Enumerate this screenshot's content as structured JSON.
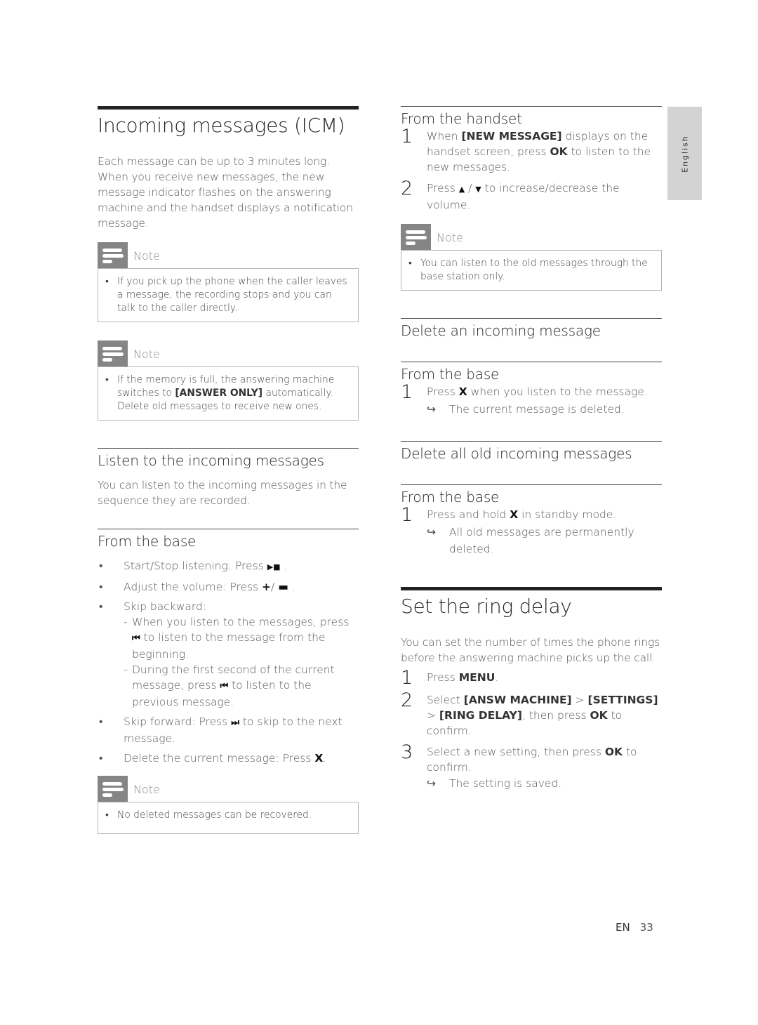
{
  "side_tab": {
    "label": "English"
  },
  "footer": {
    "lang": "EN",
    "page": "33"
  },
  "left": {
    "title": "Incoming messages (ICM)",
    "intro": "Each message can be up to 3 minutes long. When you receive new messages, the new message indicator flashes on the answering machine and the handset displays a notification message.",
    "notes": [
      {
        "label": "Note",
        "items": [
          "If you pick up the phone when the caller leaves a message, the recording stops and you can talk to the caller directly."
        ]
      },
      {
        "label": "Note",
        "items_rich": {
          "pre": "If the memory is full, the answering machine switches to ",
          "kw": "[ANSWER ONLY]",
          "post": " automatically. Delete old messages to receive new ones."
        }
      }
    ],
    "listen": {
      "heading": "Listen to the incoming messages",
      "text": "You can listen to the incoming messages in the sequence they are recorded."
    },
    "from_base": {
      "heading": "From the base",
      "bullets": {
        "start_stop": {
          "pre": "Start/Stop listening: Press ",
          "icon": "▶■",
          "post": " ."
        },
        "volume": {
          "pre": "Adjust the volume: Press ",
          "icon_plus": "+",
          "sep": "/ ",
          "icon_minus": "▬",
          "post": " ."
        },
        "skip_back": {
          "label": "Skip backward:",
          "sub1": {
            "pre": "When you listen to the messages, press ",
            "icon": "⏮",
            "post": " to listen to the message from the beginning."
          },
          "sub2": {
            "pre": "During the first second of the current message, press ",
            "icon": "⏮",
            "post": " to listen to the previous message."
          }
        },
        "skip_fwd": {
          "pre": "Skip forward: Press ",
          "icon": "⏭",
          "post": " to skip to the next message."
        },
        "delete": {
          "pre": "Delete the current message: Press ",
          "icon": "X",
          "post": "."
        }
      }
    },
    "note3": {
      "label": "Note",
      "text": "No deleted messages can be recovered."
    }
  },
  "right": {
    "handset": {
      "heading": "From the handset",
      "step1": {
        "num": "1",
        "pre": "When ",
        "kw1": "[NEW MESSAGE]",
        "mid": " displays on the handset screen, press ",
        "kw2": "OK",
        "post": " to listen to the new messages."
      },
      "step2": {
        "num": "2",
        "pre": "Press ",
        "icon_up": "▲",
        "sep": " / ",
        "icon_down": "▼",
        "post": " to increase/decrease the volume."
      }
    },
    "note": {
      "label": "Note",
      "text": "You can listen to the old messages through the base station only."
    },
    "delete_one": {
      "heading": "Delete an incoming message",
      "sub_heading": "From the base",
      "step1": {
        "num": "1",
        "pre": "Press ",
        "icon": "X",
        "post": " when you listen to the message."
      },
      "result": {
        "arrow": "↪",
        "text": "The current message is deleted."
      }
    },
    "delete_all": {
      "heading": "Delete all old incoming messages",
      "sub_heading": "From the base",
      "step1": {
        "num": "1",
        "pre": "Press and hold ",
        "icon": "X",
        "post": " in standby mode."
      },
      "result": {
        "arrow": "↪",
        "text": "All old messages are permanently deleted."
      }
    },
    "ring_delay": {
      "title": "Set the ring delay",
      "intro": "You can set the number of times the phone rings before the answering machine picks up the call.",
      "step1": {
        "num": "1",
        "pre": "Press ",
        "kw": "MENU",
        "post": "."
      },
      "step2": {
        "num": "2",
        "pre": "Select ",
        "kw1": "[ANSW MACHINE]",
        "gt1": " > ",
        "kw2": "[SETTINGS]",
        "gt2": " > ",
        "kw3": "[RING DELAY]",
        "mid": ", then press ",
        "kw4": "OK",
        "post": " to confirm."
      },
      "step3": {
        "num": "3",
        "pre": "Select a new setting, then press ",
        "kw": "OK",
        "post": " to confirm."
      },
      "result": {
        "arrow": "↪",
        "text": "The setting is saved."
      }
    }
  }
}
